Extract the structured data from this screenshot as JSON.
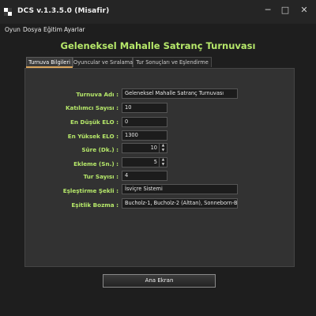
{
  "window": {
    "title": "DCS v.1.3.5.0 (Misafir)",
    "minimize": "─",
    "maximize": "□",
    "close": "✕",
    "icon": "chess-app-icon"
  },
  "menu": {
    "items": [
      "Oyun",
      "Dosya",
      "Eğitim",
      "Ayarlar"
    ]
  },
  "page_title": "Geleneksel Mahalle Satranç Turnuvası",
  "tabs": [
    {
      "label": "Turnuva Bilgileri",
      "active": true
    },
    {
      "label": "Oyuncular ve Sıralama",
      "active": false
    },
    {
      "label": "Tur Sonuçları ve Eşlendirme",
      "active": false
    }
  ],
  "form": {
    "fields": [
      {
        "label": "Turnuva Adı :",
        "value": "Geleneksel Mahalle Satranç Turnuvası"
      },
      {
        "label": "Katılımcı Sayısı :",
        "value": "10"
      },
      {
        "label": "En Düşük ELO :",
        "value": "0"
      },
      {
        "label": "En Yüksek ELO :",
        "value": "1300"
      },
      {
        "label": "Süre (Dk.) :",
        "value": "10"
      },
      {
        "label": "Ekleme (Sn.) :",
        "value": "5"
      },
      {
        "label": "Tur Sayısı :",
        "value": "4"
      },
      {
        "label": "Eşleştirme Şekli :",
        "value": "İsviçre Sistemi"
      },
      {
        "label": "Eşitlik Bozma :",
        "value": "Bucholz-1, Bucholz-2 (Alttan), Sonneborn-Berger"
      }
    ],
    "spin_up": "▲",
    "spin_down": "▼"
  },
  "main_button": "Ana Ekran",
  "colors": {
    "accent": "#b6e86a",
    "tab_underline": "#dba65c",
    "background": "#1e1e1e",
    "panel": "#323232"
  }
}
